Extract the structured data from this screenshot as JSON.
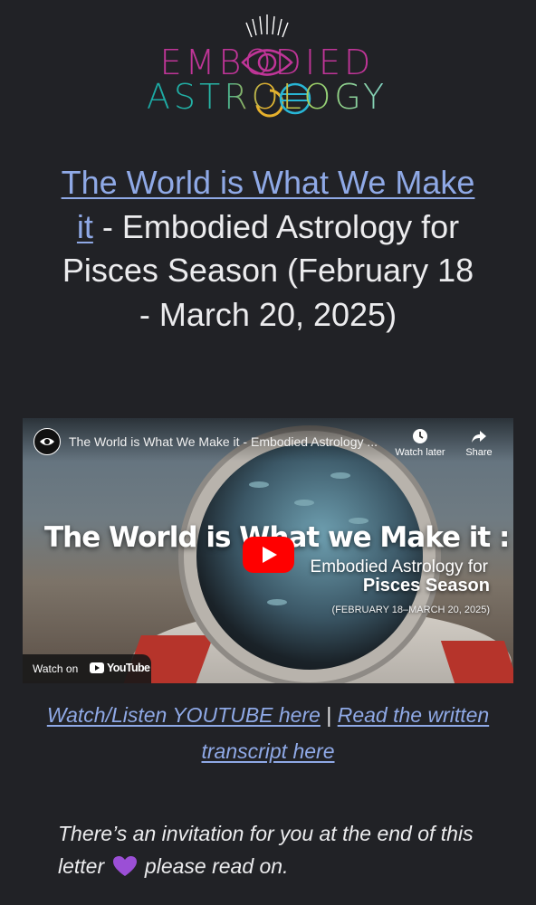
{
  "logo": {
    "line1": "EMBODIED",
    "line2": "ASTROLOGY",
    "colors": {
      "magenta": "#c03598",
      "teal": "#1aa8a4",
      "gold": "#e6b02c"
    }
  },
  "headline": {
    "link_text": "The World is What We Make it",
    "rest": " - Embodied Astrology for Pisces Season (February 18 - March 20, 2025)"
  },
  "video": {
    "title": "The World is What We Make it - Embodied Astrology ...",
    "watch_later": "Watch later",
    "share": "Share",
    "thumbnail_title": "The World is What we Make it :",
    "thumbnail_subtitle_1": "Embodied Astrology for",
    "thumbnail_subtitle_2": "Pisces Season",
    "thumbnail_dates": "(FEBRUARY 18–MARCH 20, 2025)",
    "watch_on": "Watch on",
    "youtube": "YouTube",
    "icons": [
      "channel-eye-icon",
      "clock-icon",
      "share-arrow-icon",
      "play-icon",
      "youtube-logo-icon"
    ]
  },
  "links": {
    "youtube": "Watch/Listen YOUTUBE here",
    "separator": "|",
    "transcript": "Read the written transcript here"
  },
  "invite": {
    "before": "There’s an invitation for you at the end of this letter",
    "emoji": "purple-heart-icon",
    "after": " please read on."
  },
  "colors": {
    "background": "#212226",
    "link": "#8fa9e6",
    "text": "#ececee",
    "heart": "#9b4fd6"
  }
}
